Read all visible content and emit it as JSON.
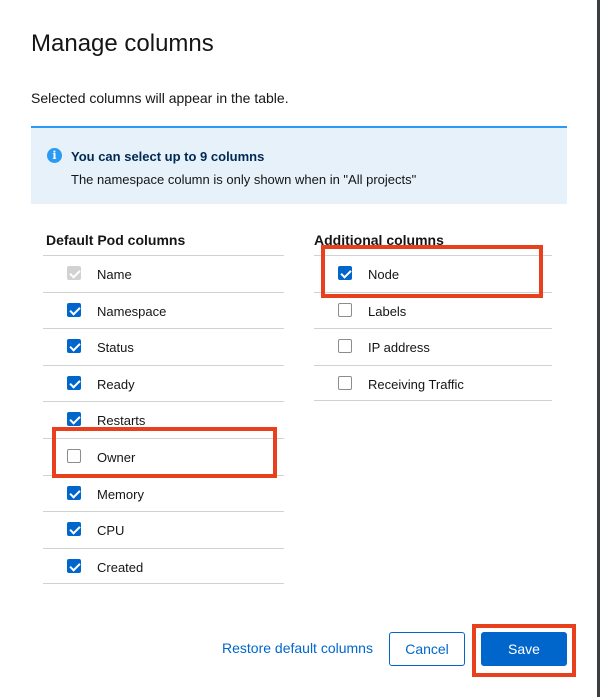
{
  "modal": {
    "title": "Manage columns",
    "description": "Selected columns will appear in the table."
  },
  "alert": {
    "icon": "info-icon",
    "title": "You can select up to 9 columns",
    "body": "The namespace column is only shown when in \"All projects\""
  },
  "default_columns": {
    "title": "Default Pod columns",
    "items": [
      {
        "label": "Name",
        "checked": true,
        "disabled": true
      },
      {
        "label": "Namespace",
        "checked": true,
        "disabled": false
      },
      {
        "label": "Status",
        "checked": true,
        "disabled": false
      },
      {
        "label": "Ready",
        "checked": true,
        "disabled": false
      },
      {
        "label": "Restarts",
        "checked": true,
        "disabled": false
      },
      {
        "label": "Owner",
        "checked": false,
        "disabled": false
      },
      {
        "label": "Memory",
        "checked": true,
        "disabled": false
      },
      {
        "label": "CPU",
        "checked": true,
        "disabled": false
      },
      {
        "label": "Created",
        "checked": true,
        "disabled": false
      }
    ]
  },
  "additional_columns": {
    "title": "Additional columns",
    "items": [
      {
        "label": "Node",
        "checked": true,
        "disabled": false
      },
      {
        "label": "Labels",
        "checked": false,
        "disabled": false
      },
      {
        "label": "IP address",
        "checked": false,
        "disabled": false
      },
      {
        "label": "Receiving Traffic",
        "checked": false,
        "disabled": false
      }
    ]
  },
  "footer": {
    "restore_label": "Restore default columns",
    "cancel_label": "Cancel",
    "save_label": "Save"
  },
  "colors": {
    "primary": "#0066cc",
    "highlight": "#e8401c",
    "alert_bg": "#e7f1fa"
  }
}
